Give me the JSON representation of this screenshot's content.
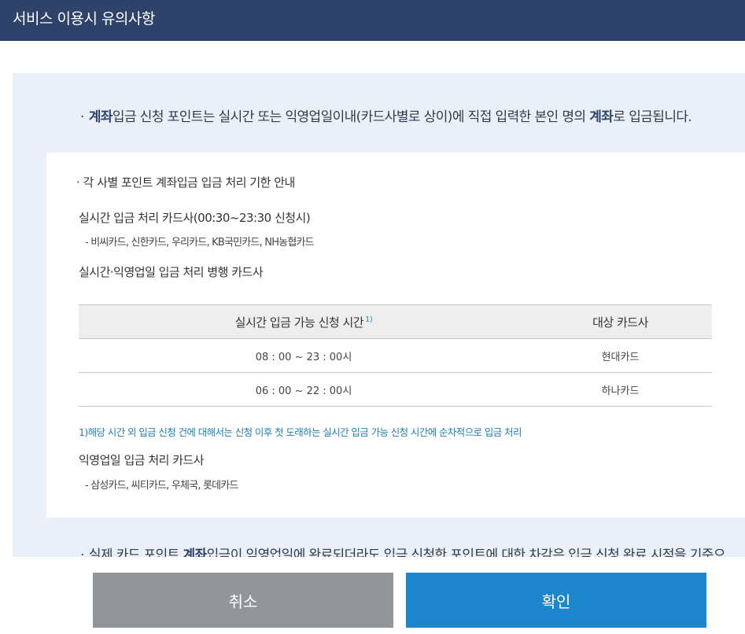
{
  "header": {
    "title": "서비스 이용시 유의사항"
  },
  "notices": {
    "first": {
      "prefix": "계좌",
      "middle": "입금 신청 포인트는 실시간 또는 익영업일이내(카드사별로 상이)에 직접 입력한 본인 명의 ",
      "bold": "계좌",
      "suffix": "로 입금됩니다."
    },
    "second": {
      "prefix": "실제 카드 포인트 ",
      "bold": "계좌",
      "suffix": "입금이 익영업일에 완료되더라도 입금 신청한 포인트에 대한 차감은 입금 신청 완료 시점을 기준으"
    }
  },
  "guide": {
    "title": "각 사별 포인트 계좌입금 입금 처리 기한 안내",
    "realtime_title": "실시간 입금 처리 카드사(00:30~23:30 신청시)",
    "realtime_list": "- 비씨카드, 신한카드, 우리카드, KB국민카드, NH농협카드",
    "parallel_title": "실시간·익영업일 입금 처리 병행 카드사",
    "table": {
      "headers": [
        "실시간 입금 가능 신청 시간",
        "대상 카드사"
      ],
      "header_note": "1)",
      "rows": [
        {
          "time": "08 : 00 ~ 23 : 00시",
          "card": "현대카드"
        },
        {
          "time": "06 : 00 ~ 22 : 00시",
          "card": "하나카드"
        }
      ]
    },
    "footnote": "1)해당 시간 외 입금 신청 건에 대해서는 신청 이후 첫 도래하는 실시간 입금 가능 신청 시간에 순차적으로 입금 처리",
    "nextday_title": "익영업일 입금 처리 카드사",
    "nextday_list": "- 삼성카드, 씨티카드, 우체국, 롯데카드"
  },
  "buttons": {
    "cancel": "취소",
    "confirm": "확인"
  },
  "colors": {
    "header_bg": "#2f4269",
    "panel_bg": "#ebf0f8",
    "confirm_bg": "#1d86cc",
    "cancel_bg": "#939699",
    "footnote": "#1f7fb8"
  }
}
